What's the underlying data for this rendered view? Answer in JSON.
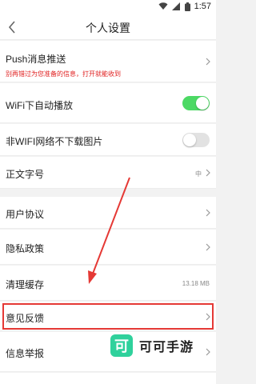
{
  "status_bar": {
    "time": "1:57"
  },
  "header": {
    "title": "个人设置"
  },
  "rows": {
    "push": {
      "label": "Push消息推送",
      "sub": "别再错过为您准备的信息，打开就能收到"
    },
    "wifi_autoplay": {
      "label": "WiFi下自动播放",
      "on": true
    },
    "non_wifi_images": {
      "label": "非WIFI网络不下载图片",
      "on": false
    },
    "font_size": {
      "label": "正文字号",
      "value": "中"
    },
    "user_agreement": {
      "label": "用户协议"
    },
    "privacy": {
      "label": "隐私政策"
    },
    "clear_cache": {
      "label": "清理缓存",
      "value": "13.18 MB"
    },
    "feedback": {
      "label": "意见反馈"
    },
    "report": {
      "label": "信息举报"
    }
  },
  "watermark": {
    "logo_char": "可",
    "text": "可可手游"
  },
  "colors": {
    "toggle_on": "#4cd964",
    "toggle_off": "#e2e2e2",
    "highlight": "#e53935",
    "hint_text": "#e02020",
    "watermark_logo": "#2fd19c"
  }
}
